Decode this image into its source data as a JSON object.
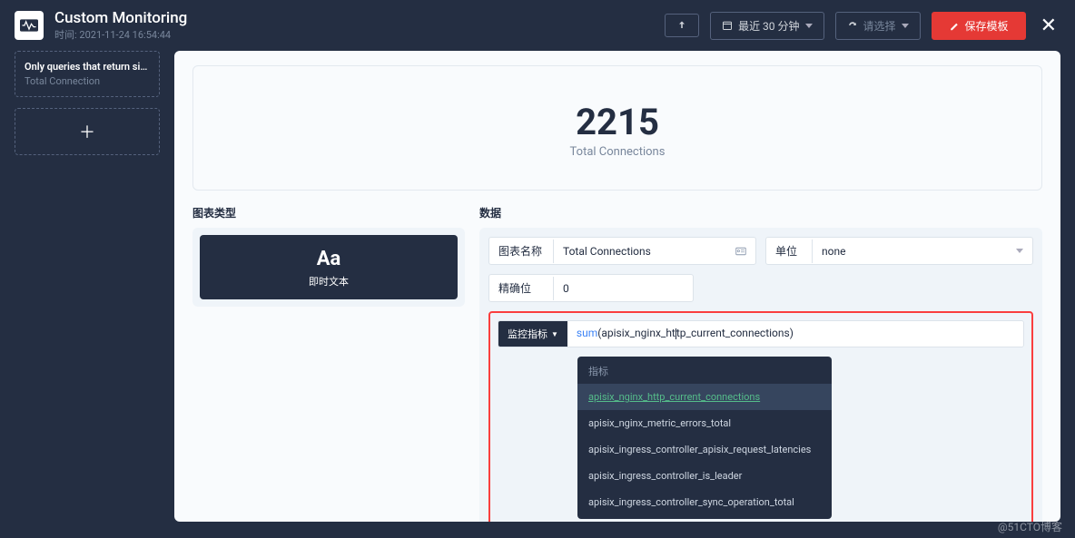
{
  "header": {
    "title": "Custom Monitoring",
    "time_prefix": "时间: ",
    "time_value": "2021-11-24 16:54:44",
    "time_range": "最近 30 分钟",
    "select_placeholder": "请选择",
    "save_label": "保存模板"
  },
  "sidebar": {
    "panels": [
      {
        "title": "Only queries that return sin…",
        "subtitle": "Total Connection"
      }
    ]
  },
  "preview": {
    "value": "2215",
    "label": "Total Connections"
  },
  "sections": {
    "chart_type_label": "图表类型",
    "data_label": "数据",
    "chart_tile_icon": "Aa",
    "chart_tile_label": "即时文本"
  },
  "form": {
    "name_label": "图表名称",
    "name_value": "Total Connections",
    "unit_label": "单位",
    "unit_value": "none",
    "decimals_label": "精确位",
    "decimals_value": "0",
    "metric_label": "监控指标",
    "metric_expr_prefix": "sum",
    "metric_expr_open": "(",
    "metric_expr_a": "apisix_nginx_ht",
    "metric_expr_b": "tp_current_connections",
    "metric_expr_close": ")"
  },
  "dropdown": {
    "header": "指标",
    "items": [
      "apisix_nginx_http_current_connections",
      "apisix_nginx_metric_errors_total",
      "apisix_ingress_controller_apisix_request_latencies",
      "apisix_ingress_controller_is_leader",
      "apisix_ingress_controller_sync_operation_total"
    ]
  },
  "watermark": "@51CTO博客"
}
